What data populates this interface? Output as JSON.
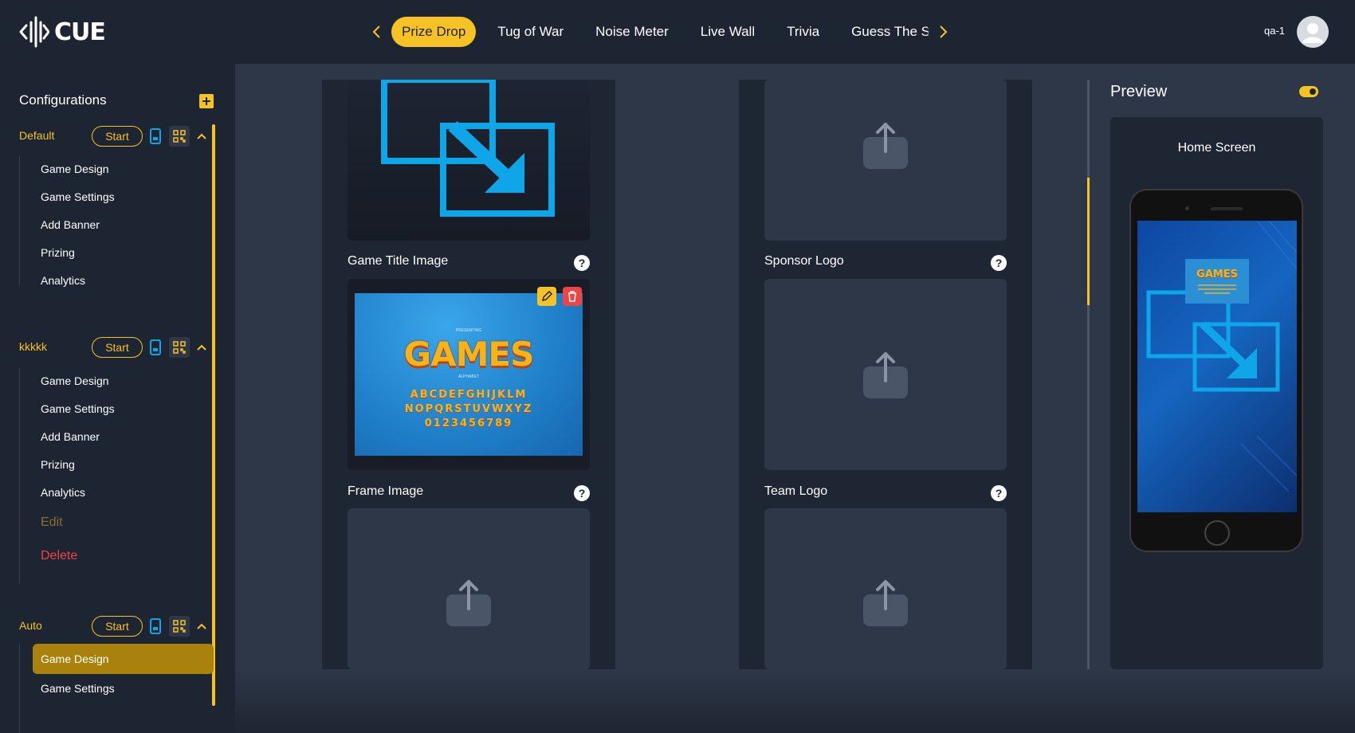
{
  "app": {
    "brand": "CUE"
  },
  "nav": {
    "tabs": [
      "Prize Drop",
      "Tug of War",
      "Noise Meter",
      "Live Wall",
      "Trivia",
      "Guess The Sc"
    ],
    "active_index": 0
  },
  "user": {
    "name": "qa-1"
  },
  "sidebar": {
    "title": "Configurations",
    "configs": [
      {
        "name": "Default",
        "start_label": "Start",
        "items": [
          "Game Design",
          "Game Settings",
          "Add Banner",
          "Prizing",
          "Analytics"
        ]
      },
      {
        "name": "kkkkk",
        "start_label": "Start",
        "items": [
          "Game Design",
          "Game Settings",
          "Add Banner",
          "Prizing",
          "Analytics"
        ],
        "edit_label": "Edit",
        "delete_label": "Delete"
      },
      {
        "name": "Auto",
        "start_label": "Start",
        "items": [
          "Game Design",
          "Game Settings"
        ],
        "active_item": "Game Design"
      }
    ]
  },
  "assets": {
    "left": [
      {
        "label": "Game Title Image",
        "help": "?"
      },
      {
        "label": "Frame Image",
        "help": "?"
      }
    ],
    "right": [
      {
        "label": "Sponsor Logo",
        "help": "?"
      },
      {
        "label": "Team Logo",
        "help": "?"
      }
    ]
  },
  "frame_image_text": {
    "presenting": "PRESENTING",
    "word": "GAMES",
    "alphabet": "ALPHABET",
    "row1": "ABCDEFGHIJKLM",
    "row2": "NOPQRSTUVWXYZ",
    "row3": "0123456789"
  },
  "preview": {
    "title": "Preview",
    "screen_title": "Home Screen",
    "mini_word": "GAMES"
  },
  "colors": {
    "accent": "#f6c224",
    "bg_dark": "#1e2532",
    "bg_main": "#2d3748",
    "image_blue": "#0ea5e9",
    "danger": "#ef4444"
  }
}
